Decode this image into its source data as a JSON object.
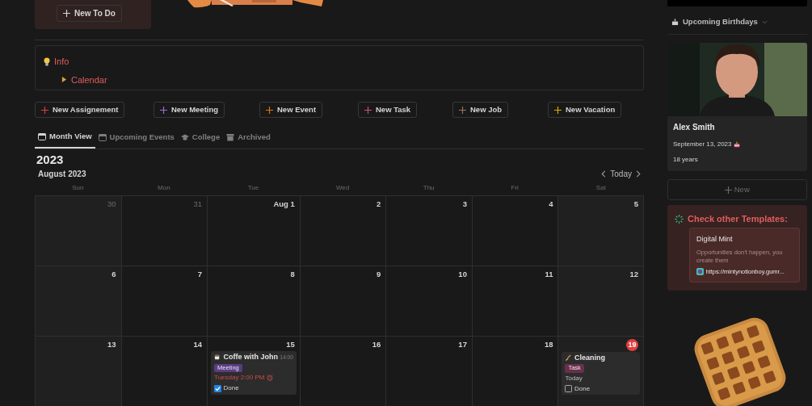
{
  "todo_card": {
    "button": "New To Do"
  },
  "callout": {
    "title": "Info",
    "items": [
      {
        "label": "Calendar",
        "expanded": false
      }
    ]
  },
  "new_buttons": [
    {
      "label": "New Assignement",
      "color": "#e03e3e"
    },
    {
      "label": "New Meeting",
      "color": "#9a6dd7"
    },
    {
      "label": "New Event",
      "color": "#d9730d"
    },
    {
      "label": "New Task",
      "color": "#d44c7e"
    },
    {
      "label": "New Job",
      "color": "#a5705a"
    },
    {
      "label": "New Vacation",
      "color": "#dfab01"
    }
  ],
  "tabs": [
    {
      "label": "Month View",
      "kind": "calendar",
      "selected": true
    },
    {
      "label": "Upcoming Events",
      "kind": "calendar",
      "selected": false
    },
    {
      "label": "College",
      "kind": "cap",
      "selected": false
    },
    {
      "label": "Archived",
      "kind": "archive",
      "selected": false
    }
  ],
  "year_heading": "2023",
  "calendar": {
    "month": "August 2023",
    "today_button": "Today",
    "weekdays": [
      "Sun",
      "Mon",
      "Tue",
      "Wed",
      "Thu",
      "Fri",
      "Sat"
    ],
    "weeks": [
      [
        {
          "day": "30",
          "in_month": false,
          "today": false
        },
        {
          "day": "31",
          "in_month": false,
          "today": false
        },
        {
          "day": "Aug 1",
          "in_month": true,
          "today": false
        },
        {
          "day": "2",
          "in_month": true,
          "today": false
        },
        {
          "day": "3",
          "in_month": true,
          "today": false
        },
        {
          "day": "4",
          "in_month": true,
          "today": false
        },
        {
          "day": "5",
          "in_month": true,
          "today": false
        }
      ],
      [
        {
          "day": "6",
          "in_month": true,
          "today": false
        },
        {
          "day": "7",
          "in_month": true,
          "today": false
        },
        {
          "day": "8",
          "in_month": true,
          "today": false
        },
        {
          "day": "9",
          "in_month": true,
          "today": false
        },
        {
          "day": "10",
          "in_month": true,
          "today": false
        },
        {
          "day": "11",
          "in_month": true,
          "today": false
        },
        {
          "day": "12",
          "in_month": true,
          "today": false
        }
      ],
      [
        {
          "day": "13",
          "in_month": true,
          "today": false
        },
        {
          "day": "14",
          "in_month": true,
          "today": false
        },
        {
          "day": "15",
          "in_month": true,
          "today": false,
          "events": [
            {
              "kind": "coffee",
              "title": "Coffe with John",
              "time": "14:00",
              "tag": {
                "label": "Meeting",
                "color": "#5a3c84"
              },
              "date": "Tuesday 2:00 PM",
              "reminder": true,
              "done_label": "Done",
              "done": true
            }
          ]
        },
        {
          "day": "16",
          "in_month": true,
          "today": false
        },
        {
          "day": "17",
          "in_month": true,
          "today": false
        },
        {
          "day": "18",
          "in_month": true,
          "today": false
        },
        {
          "day": "19",
          "in_month": true,
          "today": true,
          "events": [
            {
              "kind": "broom",
              "title": "Cleaning",
              "tag": {
                "label": "Task",
                "color": "#6b2f4b"
              },
              "date": "Today",
              "reminder": false,
              "done_label": "Done",
              "done": false
            }
          ]
        }
      ]
    ]
  },
  "sidebar": {
    "birthdays": {
      "title": "Upcoming Birthdays",
      "cards": [
        {
          "name": "Alex Smith",
          "date": "September 13, 2023",
          "age": "18 years"
        }
      ],
      "new_button": "New"
    },
    "templates": {
      "title": "Check other Templates:",
      "card": {
        "title": "Digital Mint",
        "description": "Opportunities don’t happen, you create them",
        "link": "https://mintynotionboy.gumr..."
      }
    }
  }
}
